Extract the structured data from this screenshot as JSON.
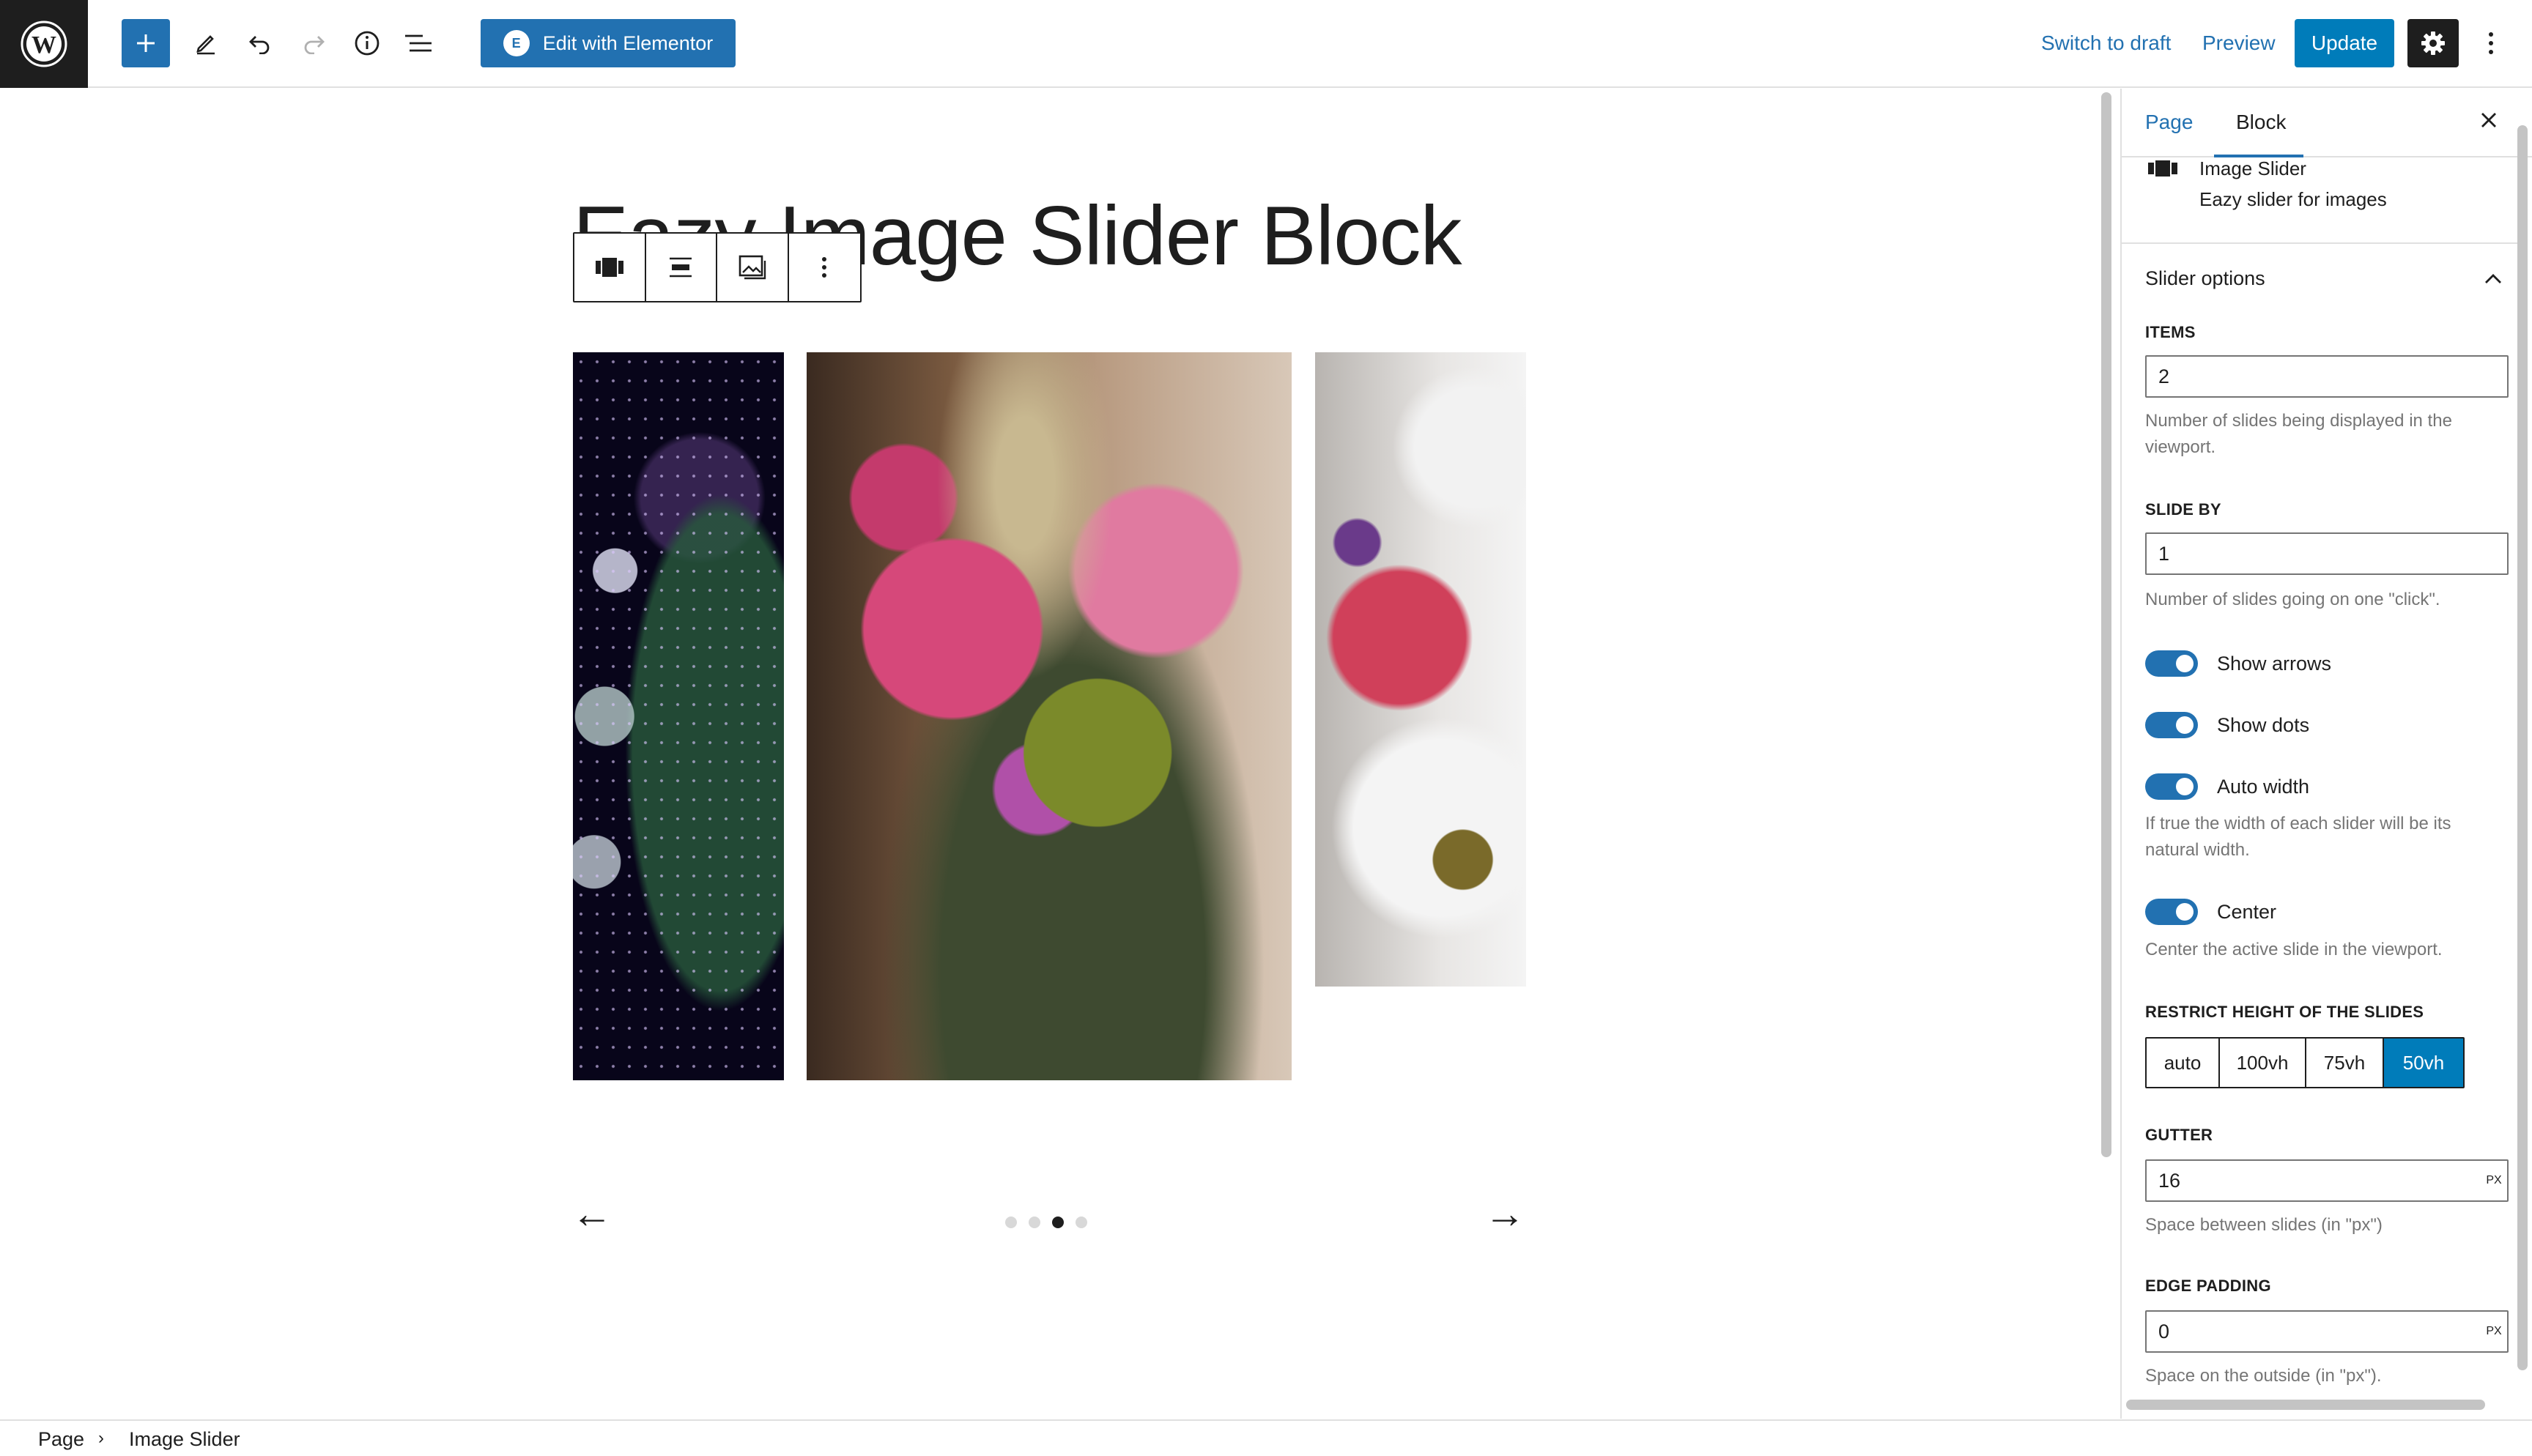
{
  "topbar": {
    "logo_icon": "wordpress-logo",
    "add_block_icon": "plus-icon",
    "tools_icon": "pencil-icon",
    "undo_icon": "undo-icon",
    "redo_icon": "redo-icon",
    "details_icon": "info-icon",
    "list_view_icon": "list-view-icon",
    "elementor_label": "Edit with Elementor",
    "switch_to_draft": "Switch to draft",
    "preview": "Preview",
    "update": "Update",
    "settings_icon": "gear-icon",
    "options_icon": "kebab-icon",
    "accent_color": "#2271b1"
  },
  "editor": {
    "title": "Eazy Image Slider Block",
    "toolbar_items": [
      "slider-block-icon",
      "align-icon",
      "replace-image-icon",
      "more-options-icon"
    ],
    "slider": {
      "slides": [
        "starry-spheres-photo",
        "flower-bouquet-photo",
        "pink-lily-daisies-photo"
      ],
      "prev_arrow": "←",
      "next_arrow": "→",
      "dot_count": 4,
      "active_dot": 3
    }
  },
  "sidebar": {
    "tabs": {
      "page": "Page",
      "block": "Block"
    },
    "block_name": "Image Slider",
    "block_description": "Eazy slider for images",
    "panel_title": "Slider options",
    "items_label": "ITEMS",
    "items_value": "2",
    "items_help": "Number of slides being displayed in the viewport.",
    "slide_by_label": "SLIDE BY",
    "slide_by_value": "1",
    "slide_by_help": "Number of slides going on one \"click\".",
    "show_arrows": "Show arrows",
    "show_dots": "Show dots",
    "auto_width": "Auto width",
    "auto_width_help": "If true the width of each slider will be its natural width.",
    "center": "Center",
    "center_help": "Center the active slide in the viewport.",
    "restrict_label": "RESTRICT HEIGHT OF THE SLIDES",
    "height_options": [
      "auto",
      "100vh",
      "75vh",
      "50vh"
    ],
    "height_selected": "50vh",
    "gutter_label": "GUTTER",
    "gutter_value": "16",
    "gutter_unit": "PX",
    "gutter_help": "Space between slides (in \"px\")",
    "edge_label": "EDGE PADDING",
    "edge_value": "0",
    "edge_unit": "PX",
    "edge_help": "Space on the outside (in \"px\")."
  },
  "footer": {
    "crumb_page": "Page",
    "crumb_sep": "›",
    "crumb_block": "Image Slider"
  }
}
